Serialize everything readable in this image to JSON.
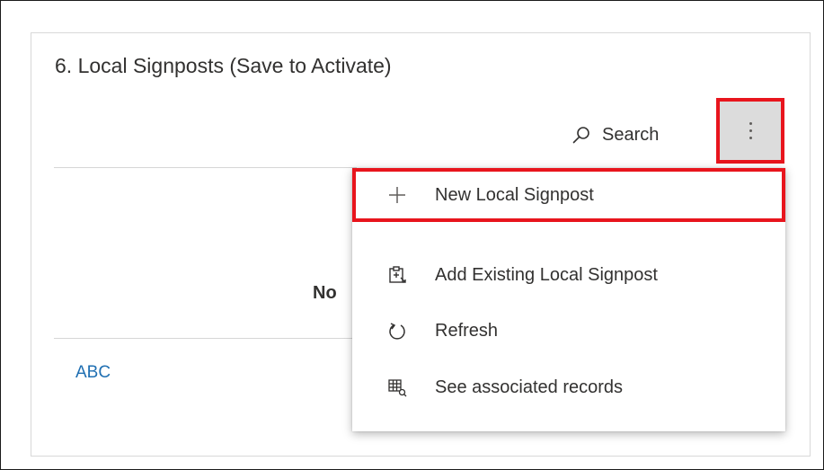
{
  "section": {
    "title": "6. Local Signposts (Save to Activate)"
  },
  "toolbar": {
    "search_label": "Search",
    "more_icon": "more-vertical-icon"
  },
  "grid": {
    "empty_text_partial": "No",
    "link_text": "ABC"
  },
  "menu": {
    "items": [
      {
        "label": "New Local Signpost",
        "icon": "plus-icon"
      },
      {
        "label": "Add Existing Local Signpost",
        "icon": "add-existing-icon"
      },
      {
        "label": "Refresh",
        "icon": "refresh-icon"
      },
      {
        "label": "See associated records",
        "icon": "associated-records-icon"
      }
    ]
  },
  "colors": {
    "highlight": "#e8151d",
    "link": "#1f6fb2",
    "text": "#323130"
  }
}
